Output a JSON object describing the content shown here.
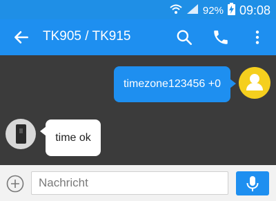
{
  "status": {
    "battery_text": "92%",
    "time": "09:08"
  },
  "header": {
    "title": "TK905 / TK915"
  },
  "messages": {
    "outgoing": {
      "text": "timezone123456 +0"
    },
    "incoming": {
      "text": "time ok"
    }
  },
  "composer": {
    "placeholder": "Nachricht"
  },
  "icons": {
    "wifi": "wifi-icon",
    "signal": "signal-icon",
    "battery": "battery-charging-icon",
    "back": "arrow-left-icon",
    "search": "search-icon",
    "phone": "phone-icon",
    "menu": "more-vert-icon",
    "add": "add-circle-icon",
    "mic": "mic-icon"
  },
  "colors": {
    "accent": "#1e8ff0",
    "chat_bg": "#3b3b3b",
    "avatar_user": "#f5cf1e"
  }
}
